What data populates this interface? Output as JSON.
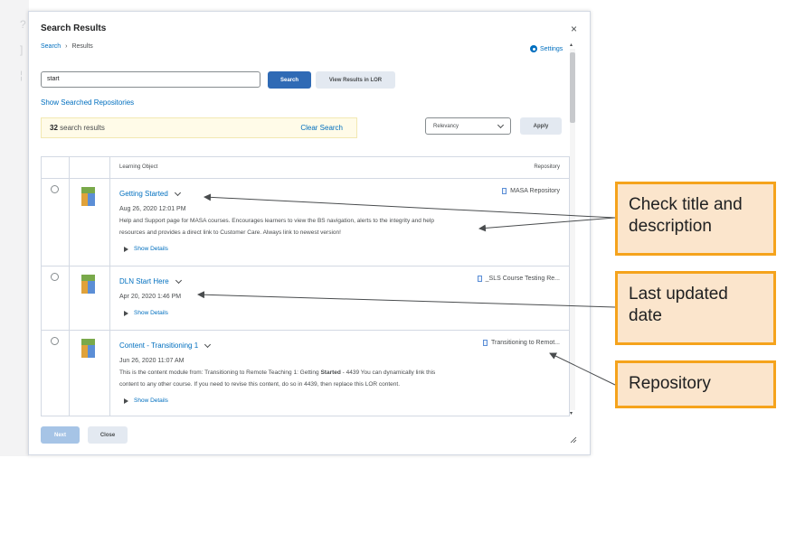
{
  "dialog": {
    "title": "Search Results",
    "close_glyph": "×",
    "breadcrumb": {
      "link": "Search",
      "separator": "›",
      "current": "Results"
    },
    "settings_label": "Settings"
  },
  "search": {
    "value": "start",
    "search_label": "Search",
    "view_lor_label": "View Results in LOR",
    "show_repos_label": "Show Searched Repositories"
  },
  "results": {
    "count": "32",
    "count_suffix": " search results",
    "clear_label": "Clear Search",
    "sort_value": "Relevancy",
    "apply_label": "Apply"
  },
  "table": {
    "headers": {
      "object": "Learning Object",
      "repository": "Repository"
    },
    "show_details_label": "Show Details",
    "rows": [
      {
        "title": "Getting Started",
        "date": "Aug 26, 2020 12:01 PM",
        "desc_line1": "Help and Support page for MASA courses. Encourages learners to view the BS navigation, alerts to the integrity and help",
        "desc_line2": "resources and provides a direct link to Customer Care. Always link to newest version!",
        "repository": "MASA Repository"
      },
      {
        "title": "DLN Start Here",
        "date": "Apr 20, 2020 1:46 PM",
        "repository": "_SLS Course Testing Re..."
      },
      {
        "title": "Content - Transitioning 1",
        "date": "Jun 26, 2020 11:07 AM",
        "desc_line1_pre": "This is the content module from: Transitioning to Remote Teaching 1: Getting ",
        "desc_line1_bold": "Started",
        "desc_line1_post": " - 4439 You can dynamically link this",
        "desc_line2": "content to any other course. If you need to revise this content, do so in 4439, then replace this LOR content.",
        "repository": "Transitioning to Remot..."
      }
    ]
  },
  "footer": {
    "next_label": "Next",
    "close_label": "Close"
  },
  "callouts": {
    "check": "Check title and description",
    "updated": "Last updated date",
    "repository": "Repository"
  },
  "colors": {
    "link": "#006fbf",
    "primary": "#2f6ab5",
    "callout_border": "#f5a31c",
    "callout_fill": "#fbe5cc"
  }
}
